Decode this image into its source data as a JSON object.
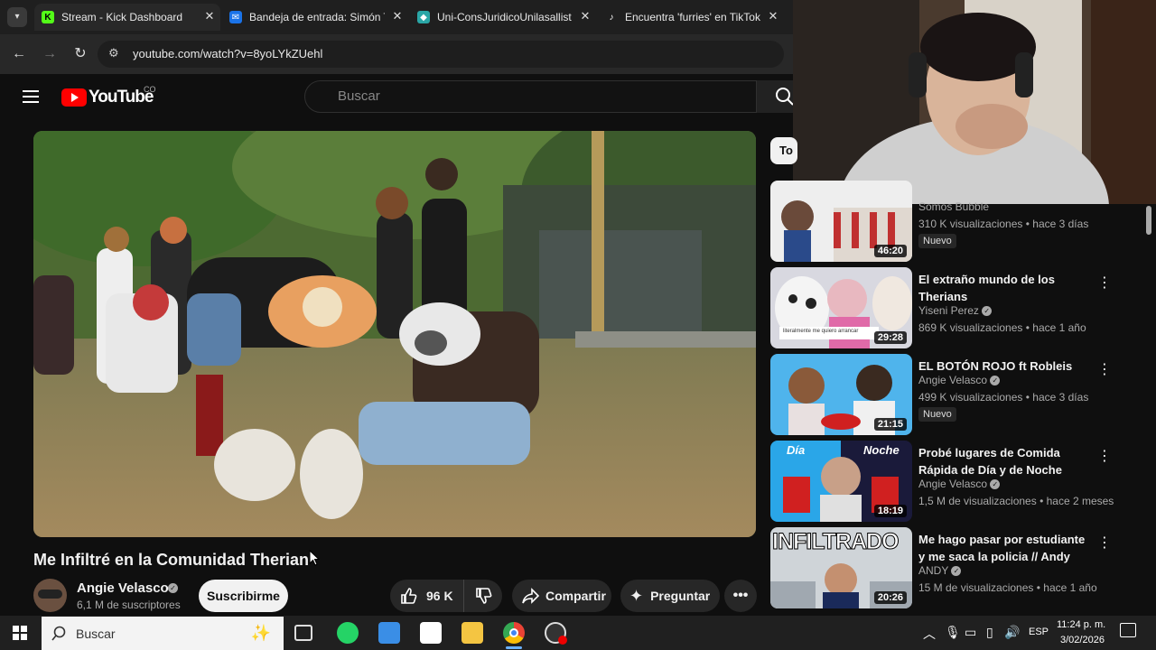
{
  "browser": {
    "tabs": [
      {
        "title": "Stream - Kick Dashboard",
        "icon": "kick-icon"
      },
      {
        "title": "Bandeja de entrada: Simón T",
        "icon": "mail-icon"
      },
      {
        "title": "Uni-ConsJuridicoUnilasallist",
        "icon": "teams-icon"
      },
      {
        "title": "Encuentra 'furries' en TikTok",
        "icon": "tiktok-icon"
      }
    ],
    "url": "youtube.com/watch?v=8yoLYkZUehl"
  },
  "youtube": {
    "logo_text": "YouTube",
    "region": "CO",
    "search_placeholder": "Buscar",
    "chip_partial": "To"
  },
  "video": {
    "title": "Me Infiltré en la Comunidad Therian",
    "channel": "Angie Velasco",
    "subscribers": "6,1 M de suscriptores",
    "subscribe_label": "Suscribirme",
    "likes": "96 K",
    "share_label": "Compartir",
    "ask_label": "Preguntar"
  },
  "recommendations": [
    {
      "title": "",
      "channel": "Somos Bubble",
      "meta": "310 K visualizaciones • hace 3 días",
      "duration": "46:20",
      "badge": "Nuevo"
    },
    {
      "title": "El extraño mundo de los Therians",
      "channel": "Yiseni Perez",
      "meta": "869 K visualizaciones • hace 1 año",
      "duration": "29:28",
      "badge": ""
    },
    {
      "title": "EL BOTÓN ROJO ft Robleis",
      "channel": "Angie Velasco",
      "meta": "499 K visualizaciones • hace 3 días",
      "duration": "21:15",
      "badge": "Nuevo"
    },
    {
      "title": "Probé lugares de Comida Rápida de Día y de Noche",
      "channel": "Angie Velasco",
      "meta": "1,5 M de visualizaciones • hace 2 meses",
      "duration": "18:19",
      "badge": ""
    },
    {
      "title": "Me hago pasar por estudiante y me saca la policia // Andy",
      "channel": "ANDY",
      "meta": "15 M de visualizaciones • hace 1 año",
      "duration": "20:26",
      "badge": ""
    }
  ],
  "thumb_text": {
    "dia": "Día",
    "noche": "Noche",
    "infiltrado": "INFILTRADO",
    "overlay": "literalmente me quiero arrancar"
  },
  "taskbar": {
    "search_placeholder": "Buscar",
    "lang": "ESP",
    "time": "11:24 p. m.",
    "date": "3/02/2026"
  },
  "colors": {
    "youtube_red": "#ff0000",
    "kick_green": "#53fc18",
    "subscribe_bg": "#f1f1f1"
  }
}
